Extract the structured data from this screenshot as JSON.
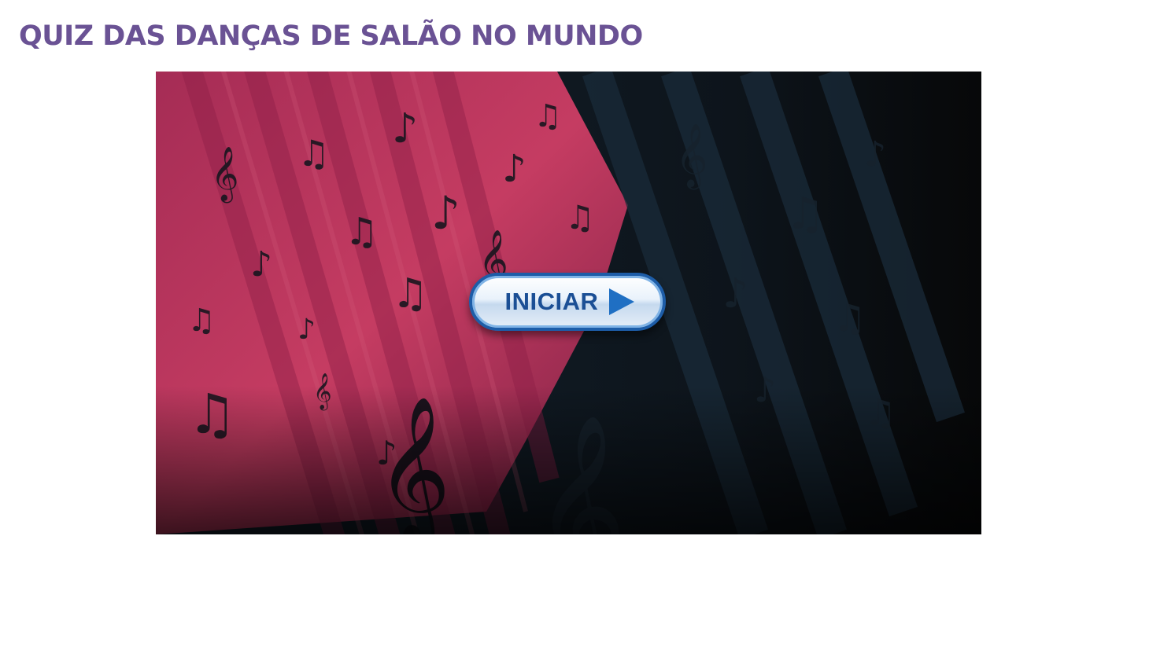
{
  "page": {
    "title": "QUIZ DAS DANÇAS DE SALÃO NO MUNDO"
  },
  "quiz": {
    "start_label": "INICIAR",
    "start_icon": "play-triangle-icon",
    "background_image": "music-notes-artwork"
  },
  "colors": {
    "title": "#6a5294",
    "button_text": "#1b4f95",
    "button_border": "#1d5da8",
    "artwork_pink": "#c2375f",
    "artwork_dark": "#0b0d10"
  }
}
